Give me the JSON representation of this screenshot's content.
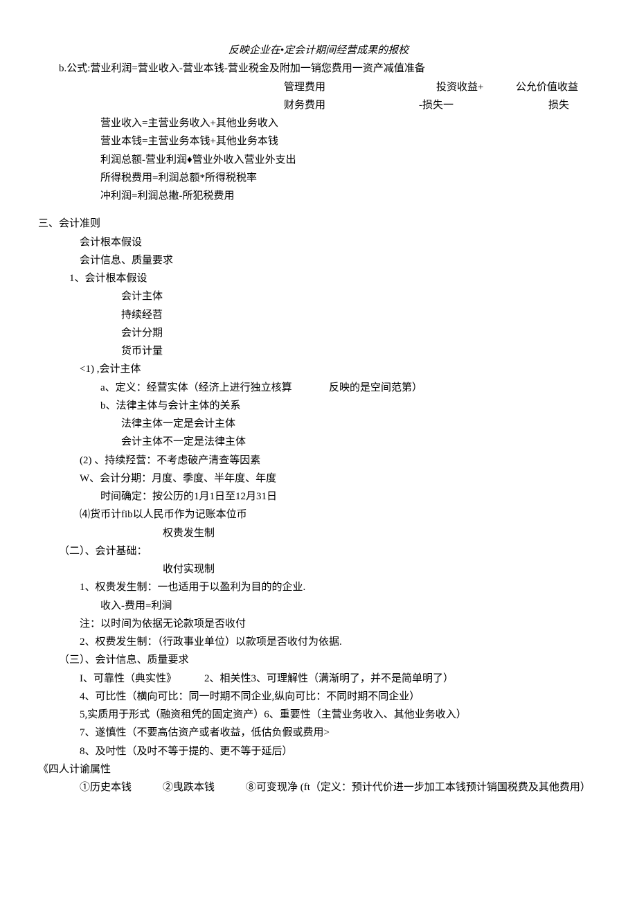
{
  "l1": "反映企业在•定会计期间经营成果的报校",
  "l2": "b.公式:营业利润=营业收入-营业本钱-营业税金及附加一销您费用一资产减值准备",
  "row1a": "管理费用",
  "row1b": "投资收益+",
  "row1c": "公允价值收益",
  "row2a": "财务费用",
  "row2b": "-损失一",
  "row2c": "损失",
  "l3": "营业收入=主营业务收入+其他业务收入",
  "l4": "营业本钱=主营业务本钱+其他业务本钱",
  "l5": "利润总额-营业利润♦管业外收入营业外支出",
  "l6": "所得税费用=利润总额*所得税税率",
  "l7": "冲利润=利润总撇-所犯税费用",
  "l8": "三、会计准则",
  "l9": "会计根本假设",
  "l10": "会计信息、质量要求",
  "l11": "1、会计根本假设",
  "l12": "会计主体",
  "l13": "持续经苕",
  "l14": "会计分期",
  "l15": "货币计量",
  "l16": "<1) ,会计主体",
  "l17a": "a、定义：经营实体（经济上进行独立核算",
  "l17b": "反映的是空间范第）",
  "l18": "b、法律主体与会计主体的关系",
  "l19": "法律主体一定是会计主体",
  "l20": "会计主体不一定是法律主体",
  "l21": "(2) 、持续羟营：不考虑破产清查等因素",
  "l22": "W、会计分期：月度、季度、半年度、年度",
  "l23": "时间确定：按公历的1月1日至12月31日",
  "l24": "⑷货币计fib以人民币作为记账本位币",
  "l25": "权贵发生制",
  "l26": "（二）、会计基础：",
  "l27": "收付实现制",
  "l28": "1、权贵发生制：一也适用于以盈利为目的的企业.",
  "l29": "收入-费用=利涧",
  "l30": "注：以时间为依据无论款项是否收付",
  "l31": "2、权费发生制：（行政事业单位）以款项是否收付为依据.",
  "l32": "（三）、会计信息、质量要求",
  "l33": "I、可靠性（典实性》",
  "l33b": "2、相关性3、可理解性（满渐明了，并不是简单明了）",
  "l34": "4、可比性（横向可比：同一时期不同企业,纵向可比：不同时期不同企业）",
  "l35": "5,实质用于形式（融资租凭的固定资产）6、重要性（主营业务收入、其他业务收入）",
  "l36": "7、遂慎性（不要高估资产或者收益，低估负假或费用>",
  "l37": "8、及吋性（及吋不等于提的、更不等于延后）",
  "l38": "《四人计谕属性",
  "l39a": "①历史本钱",
  "l39b": "②曳跌本钱",
  "l39c": "⑧可变现净 (ft（定义：预计代价进一步加工本钱预计销国税费及其他费用）"
}
